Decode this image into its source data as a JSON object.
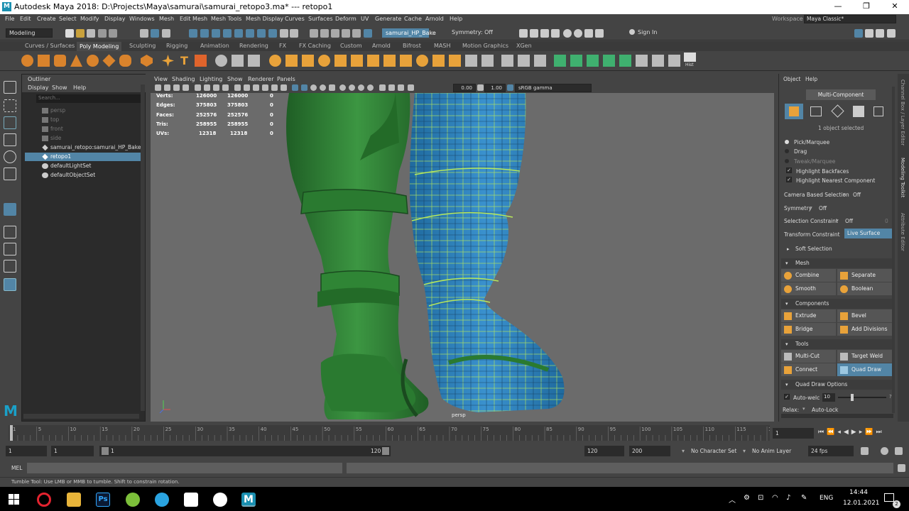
{
  "window": {
    "title": "Autodesk Maya 2018: D:\\Projects\\Maya\\samurai\\samurai_retopo3.ma*   ---   retopo1",
    "workspace_label": "Workspace :",
    "workspace_value": "Maya Classic*",
    "logo_letter": "M"
  },
  "menubar": [
    "File",
    "Edit",
    "Create",
    "Select",
    "Modify",
    "Display",
    "Windows",
    "Mesh",
    "Edit Mesh",
    "Mesh Tools",
    "Mesh Display",
    "Curves",
    "Surfaces",
    "Deform",
    "UV",
    "Generate",
    "Cache",
    "Arnold",
    "Help"
  ],
  "statusline": {
    "mode": "Modeling",
    "object_field": "samurai_HP_Bake",
    "symmetry": "Symmetry: Off",
    "sign_in": "Sign In"
  },
  "shelf_tabs": [
    "Curves / Surfaces",
    "Poly Modeling",
    "Sculpting",
    "Rigging",
    "Animation",
    "Rendering",
    "FX",
    "FX Caching",
    "Custom",
    "Arnold",
    "Bifrost",
    "MASH",
    "Motion Graphics",
    "XGen"
  ],
  "shelf_active": "Poly Modeling",
  "shelf_hist_label": "Hist",
  "outliner": {
    "title": "Outliner",
    "menu": [
      "Display",
      "Show",
      "Help"
    ],
    "search_placeholder": "Search...",
    "items": [
      {
        "label": "persp",
        "state": "dim"
      },
      {
        "label": "top",
        "state": "dim"
      },
      {
        "label": "front",
        "state": "dim"
      },
      {
        "label": "side",
        "state": "dim"
      },
      {
        "label": "samurai_retopo:samurai_HP_Bake",
        "state": "normal"
      },
      {
        "label": "retopo1",
        "state": "selected"
      },
      {
        "label": "defaultLightSet",
        "state": "normal"
      },
      {
        "label": "defaultObjectSet",
        "state": "normal"
      }
    ]
  },
  "viewport": {
    "menu": [
      "View",
      "Shading",
      "Lighting",
      "Show",
      "Renderer",
      "Panels"
    ],
    "exposure": "0.00",
    "gamma": "1.00",
    "color_space": "sRGB gamma",
    "camera_label": "persp",
    "hud": [
      {
        "label": "Verts:",
        "a": "126000",
        "b": "126000",
        "c": "0"
      },
      {
        "label": "Edges:",
        "a": "375803",
        "b": "375803",
        "c": "0"
      },
      {
        "label": "Faces:",
        "a": "252576",
        "b": "252576",
        "c": "0"
      },
      {
        "label": "Tris:",
        "a": "258955",
        "b": "258955",
        "c": "0"
      },
      {
        "label": "UVs:",
        "a": "12318",
        "b": "12318",
        "c": "0"
      }
    ]
  },
  "modeling_toolkit": {
    "menu": [
      "Object",
      "Help"
    ],
    "mode_button": "Multi-Component",
    "selection_info": "1 object selected",
    "pick_marquee": "Pick/Marquee",
    "drag": "Drag",
    "tweak_marquee": "Tweak/Marquee",
    "highlight_backfaces": "Highlight Backfaces",
    "highlight_nearest": "Highlight Nearest Component",
    "camera_based_label": "Camera Based Selection",
    "camera_based_value": "Off",
    "symmetry_label": "Symmetry",
    "symmetry_value": "Off",
    "selection_constraint_label": "Selection Constraint",
    "selection_constraint_value": "Off",
    "selection_constraint_num": "0",
    "transform_constraint_label": "Transform Constraint",
    "transform_constraint_value": "Live Surface",
    "soft_selection": "Soft Selection",
    "mesh_section": "Mesh",
    "combine": "Combine",
    "separate": "Separate",
    "smooth": "Smooth",
    "boolean": "Boolean",
    "components_section": "Components",
    "extrude": "Extrude",
    "bevel": "Bevel",
    "bridge": "Bridge",
    "add_divisions": "Add Divisions",
    "tools_section": "Tools",
    "multi_cut": "Multi-Cut",
    "target_weld": "Target Weld",
    "connect": "Connect",
    "quad_draw": "Quad Draw",
    "quad_draw_options": "Quad Draw Options",
    "auto_weld_label": "Auto-welc",
    "auto_weld_value": "10",
    "auto_weld_q": "?",
    "relax_label": "Relax:",
    "relax_value": "Auto-Lock"
  },
  "side_tabs": [
    "Channel Box / Layer Editor",
    "Modeling Toolkit",
    "Attribute Editor"
  ],
  "timeline": {
    "ticks": [
      "1",
      "5",
      "10",
      "15",
      "20",
      "25",
      "30",
      "35",
      "40",
      "45",
      "50",
      "55",
      "60",
      "65",
      "70",
      "75",
      "80",
      "85",
      "90",
      "95",
      "100",
      "105",
      "110",
      "115",
      "120"
    ],
    "current_frame": "1"
  },
  "range": {
    "start": "1",
    "playback_start": "1",
    "slider_start": "1",
    "slider_end": "120",
    "playback_end": "120",
    "end": "200",
    "character_set": "No Character Set",
    "anim_layer": "No Anim Layer",
    "fps": "24 fps"
  },
  "mel_label": "MEL",
  "help_line": "Tumble Tool: Use LMB or MMB to tumble. Shift to constrain rotation.",
  "taskbar": {
    "language": "ENG",
    "time": "14:44",
    "date": "12.01.2021",
    "ps_label": "Ps",
    "maya_label": "M",
    "notif_count": "2"
  },
  "colors": {
    "accent": "#5285a6",
    "green_mesh": "#2d7a32",
    "blue_mesh": "#2f7fb8",
    "wire": "#b8e85a"
  }
}
